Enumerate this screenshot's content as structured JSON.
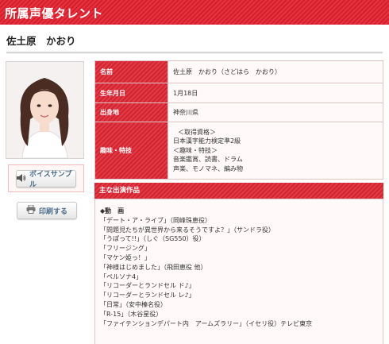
{
  "header": {
    "title": "所属声優タレント"
  },
  "talent": {
    "name": "佐土原　かおり"
  },
  "profile": {
    "rows": [
      {
        "label": "名前",
        "value": "佐土原　かおり（さどはら　かおり）"
      },
      {
        "label": "生年月日",
        "value": "1月18日"
      },
      {
        "label": "出身地",
        "value": "神奈川県"
      },
      {
        "label": "趣味・特技",
        "lines": [
          "＜取得資格＞",
          "日本漢字能力検定準2級",
          "＜趣味・特技＞",
          "音楽鑑賞、読書、ドラム",
          "声楽、モノマネ、編み物"
        ]
      }
    ]
  },
  "buttons": {
    "voice_sample": "ボイスサンプル",
    "print": "印刷する"
  },
  "works": {
    "header": "主な出演作品",
    "category": "◆動　画",
    "items": [
      "「デート・ア・ライブ」（岡峰珠恵役）",
      "「問題児たちが異世界から来るそうですよ？」（サンドラ役）",
      "「うぽって!!」（しぐ（SG550）役）",
      "「フリージング」",
      "「マケン姫っ！」",
      "「神様はじめました」（飛田恵役 他）",
      "「ペルソナ4」",
      "「リコーダーとランドセル ド♪」",
      "「リコーダーとランドセル レ♪」",
      "「日常」（安中榛名役）",
      "「R-15」（木谷星役）",
      "「ファイテンションデパート内　アームズラリー」（イセリ役）テレビ東京"
    ]
  },
  "colors": {
    "brand_red": "#d21f2c",
    "cell_bg": "#fff9f9",
    "border": "#e3c4c6"
  },
  "icons": {
    "voice": "speaker-icon",
    "print": "printer-icon"
  }
}
